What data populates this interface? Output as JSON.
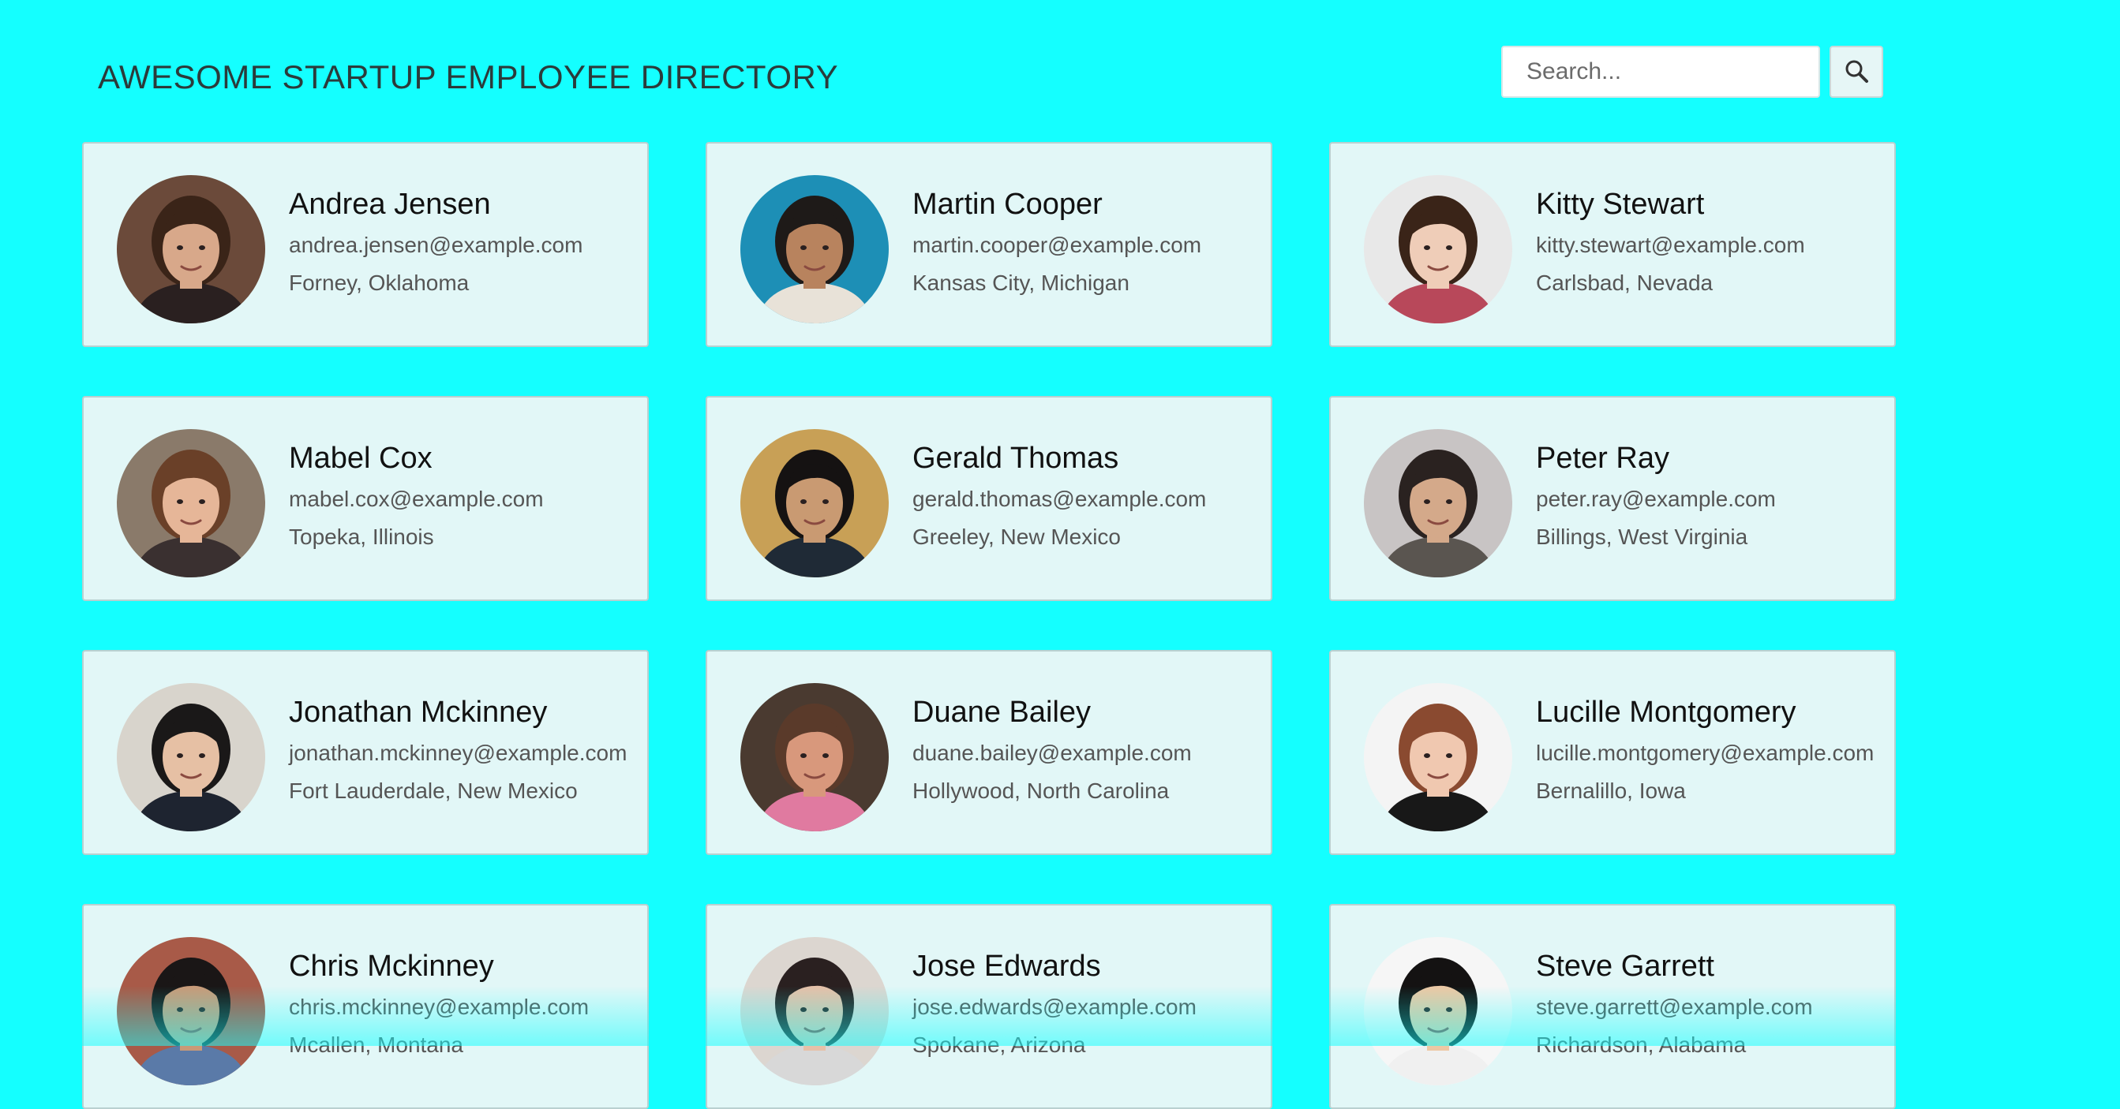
{
  "header": {
    "title": "AWESOME STARTUP EMPLOYEE DIRECTORY",
    "search_placeholder": "Search...",
    "search_icon": "magnifier-icon"
  },
  "colors": {
    "background": "#14ffff",
    "card": "#e2f7f7",
    "card_border": "#b9d0d0"
  },
  "employees": [
    {
      "name": "Andrea Jensen",
      "email": "andrea.jensen@example.com",
      "location": "Forney, Oklahoma",
      "skin": "#d8a88a",
      "hair": "#3a2418",
      "bg": "#6b4a3a",
      "shirt": "#2a2020"
    },
    {
      "name": "Martin Cooper",
      "email": "martin.cooper@example.com",
      "location": "Kansas City, Michigan",
      "skin": "#b8835e",
      "hair": "#1e1a18",
      "bg": "#1d8fb6",
      "shirt": "#e8e2d8"
    },
    {
      "name": "Kitty Stewart",
      "email": "kitty.stewart@example.com",
      "location": "Carlsbad, Nevada",
      "skin": "#efcdb8",
      "hair": "#3a2418",
      "bg": "#e8e8e8",
      "shirt": "#b8485a"
    },
    {
      "name": "Mabel Cox",
      "email": "mabel.cox@example.com",
      "location": "Topeka, Illinois",
      "skin": "#e6b698",
      "hair": "#6a4028",
      "bg": "#8a7a6a",
      "shirt": "#3a3030"
    },
    {
      "name": "Gerald Thomas",
      "email": "gerald.thomas@example.com",
      "location": "Greeley, New Mexico",
      "skin": "#c99a72",
      "hair": "#151212",
      "bg": "#c8a056",
      "shirt": "#1f2a36"
    },
    {
      "name": "Peter Ray",
      "email": "peter.ray@example.com",
      "location": "Billings, West Virginia",
      "skin": "#d4a98a",
      "hair": "#2a2220",
      "bg": "#c8c4c4",
      "shirt": "#5a5550"
    },
    {
      "name": "Jonathan Mckinney",
      "email": "jonathan.mckinney@example.com",
      "location": "Fort Lauderdale, New Mexico",
      "skin": "#e6c0a4",
      "hair": "#1a1818",
      "bg": "#d8d4cc",
      "shirt": "#1e2430"
    },
    {
      "name": "Duane Bailey",
      "email": "duane.bailey@example.com",
      "location": "Hollywood, North Carolina",
      "skin": "#d8987c",
      "hair": "#5a3a2a",
      "bg": "#4a3a30",
      "shirt": "#e07aa0"
    },
    {
      "name": "Lucille Montgomery",
      "email": "lucille.montgomery@example.com",
      "location": "Bernalillo, Iowa",
      "skin": "#f0c8b0",
      "hair": "#8a4a30",
      "bg": "#f4f4f4",
      "shirt": "#181818"
    },
    {
      "name": "Chris Mckinney",
      "email": "chris.mckinney@example.com",
      "location": "Mcallen, Montana",
      "skin": "#c99a78",
      "hair": "#1a1616",
      "bg": "#a85a48",
      "shirt": "#5a7aa8"
    },
    {
      "name": "Jose Edwards",
      "email": "jose.edwards@example.com",
      "location": "Spokane, Arizona",
      "skin": "#e6c0a8",
      "hair": "#2a2020",
      "bg": "#dcd6d0",
      "shirt": "#d8d8d8"
    },
    {
      "name": "Steve Garrett",
      "email": "steve.garrett@example.com",
      "location": "Richardson, Alabama",
      "skin": "#edc8a4",
      "hair": "#141212",
      "bg": "#f6f6f6",
      "shirt": "#f0f0f0"
    }
  ]
}
